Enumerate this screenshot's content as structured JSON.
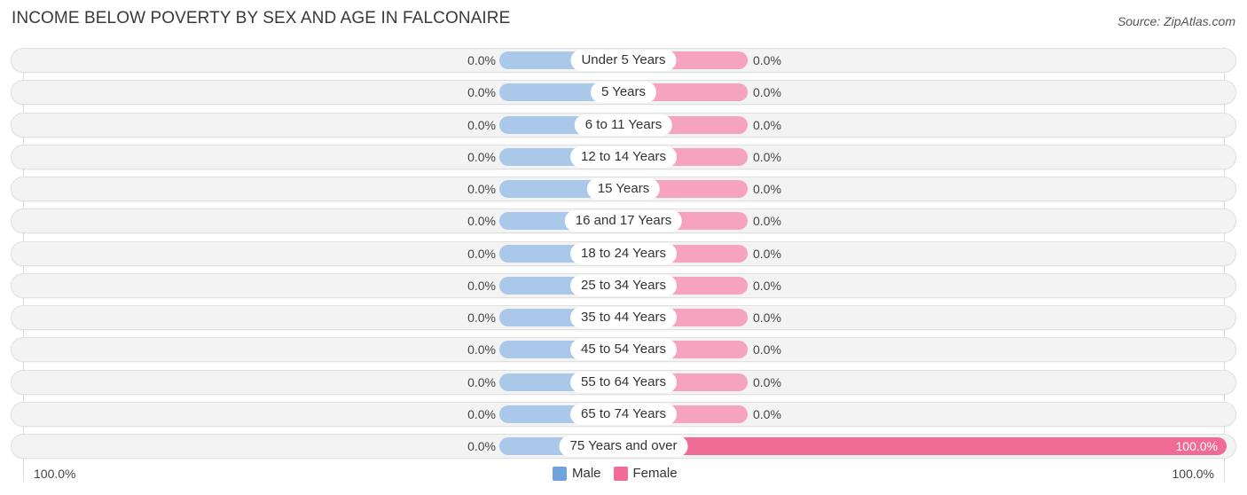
{
  "header": {
    "title": "INCOME BELOW POVERTY BY SEX AND AGE IN FALCONAIRE",
    "source": "Source: ZipAtlas.com"
  },
  "colors": {
    "male": "#a9c8ea",
    "male_legend": "#6fa3dc",
    "female": "#f5a3bf",
    "female_full": "#f06b96",
    "row_bg": "#f3f3f3"
  },
  "legend": {
    "male_label": "Male",
    "female_label": "Female"
  },
  "axis": {
    "left_label": "100.0%",
    "right_label": "100.0%"
  },
  "chart_data": {
    "type": "bar",
    "orientation": "horizontal-diverging",
    "title": "INCOME BELOW POVERTY BY SEX AND AGE IN FALCONAIRE",
    "xlabel": "",
    "ylabel": "",
    "xlim": [
      -100,
      100
    ],
    "legend_position": "bottom-center",
    "categories": [
      "Under 5 Years",
      "5 Years",
      "6 to 11 Years",
      "12 to 14 Years",
      "15 Years",
      "16 and 17 Years",
      "18 to 24 Years",
      "25 to 34 Years",
      "35 to 44 Years",
      "45 to 54 Years",
      "55 to 64 Years",
      "65 to 74 Years",
      "75 Years and over"
    ],
    "series": [
      {
        "name": "Male",
        "values": [
          0,
          0,
          0,
          0,
          0,
          0,
          0,
          0,
          0,
          0,
          0,
          0,
          0
        ],
        "labels": [
          "0.0%",
          "0.0%",
          "0.0%",
          "0.0%",
          "0.0%",
          "0.0%",
          "0.0%",
          "0.0%",
          "0.0%",
          "0.0%",
          "0.0%",
          "0.0%",
          "0.0%"
        ]
      },
      {
        "name": "Female",
        "values": [
          0,
          0,
          0,
          0,
          0,
          0,
          0,
          0,
          0,
          0,
          0,
          0,
          100
        ],
        "labels": [
          "0.0%",
          "0.0%",
          "0.0%",
          "0.0%",
          "0.0%",
          "0.0%",
          "0.0%",
          "0.0%",
          "0.0%",
          "0.0%",
          "0.0%",
          "0.0%",
          "100.0%"
        ]
      }
    ]
  }
}
